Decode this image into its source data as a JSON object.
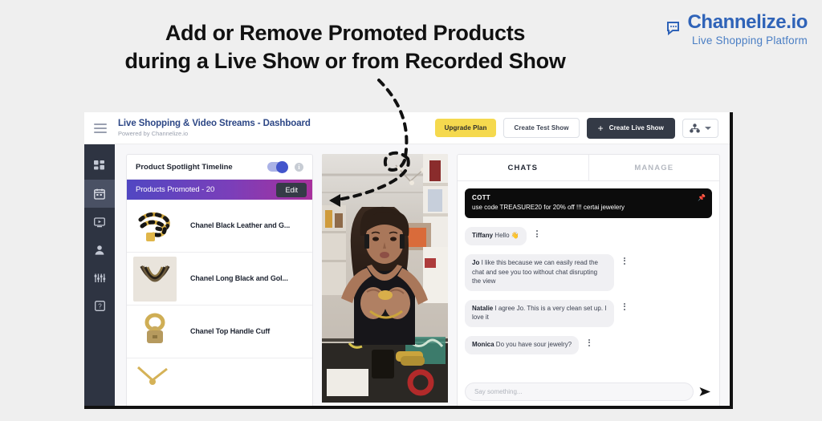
{
  "headline": {
    "line1": "Add or Remove Promoted Products",
    "line2": "during a Live Show or from Recorded Show"
  },
  "brand": {
    "name": "Channelize.io",
    "tagline": "Live Shopping Platform",
    "color": "#2f63b8"
  },
  "topbar": {
    "title": "Live Shopping & Video Streams - Dashboard",
    "subtitle": "Powered by Channelize.io",
    "buttons": {
      "upgrade": "Upgrade Plan",
      "test_show": "Create Test Show",
      "live_show": "Create Live Show",
      "live_show_plus": "+"
    },
    "upgrade_color": "#f5d94e",
    "live_show_color": "#343a46"
  },
  "sidebar": {
    "items": [
      {
        "icon": "dashboard-grid-icon",
        "active": false
      },
      {
        "icon": "calendar-icon",
        "active": true
      },
      {
        "icon": "video-play-icon",
        "active": false
      },
      {
        "icon": "person-icon",
        "active": false
      },
      {
        "icon": "sliders-icon",
        "active": false
      },
      {
        "icon": "help-question-icon",
        "active": false
      }
    ],
    "background": "#2e3442"
  },
  "products_panel": {
    "spotlight_title": "Product Spotlight Timeline",
    "toggle_on": true,
    "promoted_label": "Products Promoted - 20",
    "promoted_count": 20,
    "edit_label": "Edit",
    "gradient_from": "#5147c2",
    "gradient_to": "#a8309c",
    "items": [
      {
        "name": "Chanel Black Leather and G..."
      },
      {
        "name": "Chanel Long Black and Gol..."
      },
      {
        "name": "Chanel Top Handle Cuff"
      },
      {
        "name": ""
      }
    ]
  },
  "chat_panel": {
    "tabs": [
      {
        "label": "CHATS",
        "active": true
      },
      {
        "label": "MANAGE",
        "active": false
      }
    ],
    "pinned": {
      "author": "COTT",
      "text": "use code TREASURE20 for 20% off !!! certai jewelery",
      "icon": "pin-icon"
    },
    "messages": [
      {
        "author": "Tiffany",
        "text": " Hello 👋"
      },
      {
        "author": "Jo",
        "text": " I like this because we can easily read the chat and see you too without chat disrupting the view"
      },
      {
        "author": "Natalie",
        "text": " I agree Jo. This is a very clean set up. I love it"
      },
      {
        "author": "Monica",
        "text": " Do you have sour jewelry?"
      }
    ],
    "input_placeholder": "Say something...",
    "input_value": ""
  }
}
